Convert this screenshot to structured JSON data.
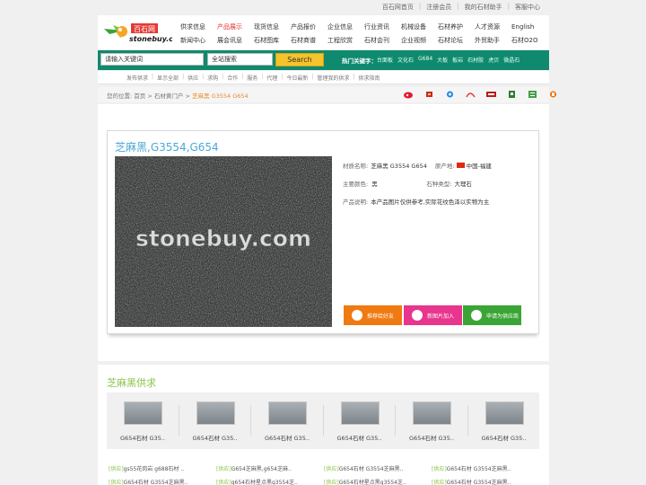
{
  "top_links": [
    "百石网首页",
    "注册会员",
    "我的石材助手",
    "客服中心"
  ],
  "logo": {
    "brand_cn": "百石网",
    "brand_en": "stonebuy.com"
  },
  "nav": {
    "row1": [
      "供求信息",
      "产品展示",
      "现货信息",
      "产品报价",
      "企业信息",
      "行业资讯",
      "机械设备",
      "石材养护",
      "人才资源",
      "English"
    ],
    "row2": [
      "新闻中心",
      "展会讯息",
      "石材图库",
      "石材商谱",
      "工程欣赏",
      "石材会刊",
      "企业视频",
      "石材论坛",
      "外贸助手",
      "石材O2O"
    ],
    "active": "产品展示"
  },
  "search": {
    "keyword_placeholder": "请输入关键词",
    "scope": "全站搜索",
    "button": "Search",
    "hot_label": "热门关键字：",
    "hot_words": [
      "台面板",
      "文化石",
      "G684",
      "大板",
      "板岩",
      "石材胶",
      "虎贝",
      "微晶石"
    ]
  },
  "subnav": [
    "发布供求",
    "显示全部",
    "供应",
    "求购",
    "合作",
    "服务",
    "代理",
    "今日最新",
    "管理我的供求",
    "供求指南"
  ],
  "breadcrumb": {
    "prefix": "您的位置:",
    "home": "首页",
    "section": "石材黄门户",
    "current": "芝麻黑 G3554 G654",
    "sep": ">"
  },
  "share_icons": [
    "weibo-icon",
    "qzone-icon",
    "tencent-weibo-icon",
    "renren-icon",
    "kaixin-icon",
    "douban-icon",
    "netease-icon",
    "sohu-icon"
  ],
  "product": {
    "title": "芝麻黑,G3554,G654",
    "watermark": "stonebuy.com",
    "name_label": "材质名称:",
    "name": "芝麻黑 G3554 G654",
    "origin_label": "原产地:",
    "origin": "中国-福建",
    "color_label": "主要颜色:",
    "color": "黑",
    "type_label": "石种类型:",
    "type": "大理石",
    "note_label": "产品说明:",
    "note": "本产品图片仅供参考,实际花纹色泽以实物为主"
  },
  "actions": {
    "recommend": "推荐给好友",
    "add_image": "新图片加入",
    "apply_supplier": "申请为供应商",
    "colors": {
      "recommend": "#f07a12",
      "add_image": "#e8358d",
      "apply_supplier": "#3aa534"
    }
  },
  "supply": {
    "title": "芝麻黑供求",
    "thumbs": [
      "G654石材 G35..",
      "G654石材 G35..",
      "G654石材 G35..",
      "G654石材 G35..",
      "G654石材 G35..",
      "G654石材 G35.."
    ],
    "list_tag": "[供应]",
    "list_row1": [
      "gs55花岗岩 g688石材 ..",
      "G654芝麻黑,g654芝麻..",
      "G654石材 G3554芝麻黑..",
      "G654石材 G3554芝麻黑.."
    ],
    "list_row2": [
      "G654石材 G3554芝麻黑..",
      "g654石材星点黑g3554芝..",
      "G654石材星点黑g3554芝..",
      "G654石材 G3554芝麻黑.."
    ]
  },
  "colors": {
    "brand_green": "#0f8a6e",
    "search_yellow": "#f5c32b",
    "title_blue": "#4aa8d8",
    "supply_green": "#8bc34a",
    "active_red": "#e5322f"
  }
}
